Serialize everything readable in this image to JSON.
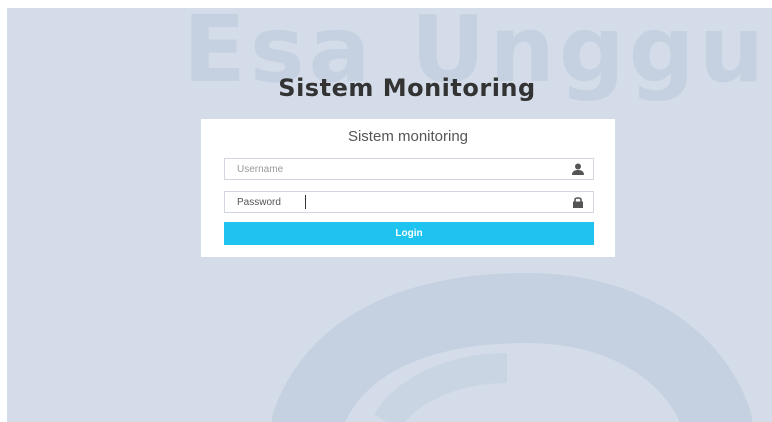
{
  "watermark": {
    "text": "Esa Unggul"
  },
  "page": {
    "title": "Sistem Monitoring"
  },
  "login_box": {
    "title": "Sistem monitoring",
    "username": {
      "placeholder": "Username",
      "value": "",
      "icon": "user-icon"
    },
    "password": {
      "placeholder": "Password",
      "value": "Password",
      "icon": "lock-icon"
    },
    "login_label": "Login"
  },
  "colors": {
    "background": "#d3dce8",
    "watermark": "#c5d1e0",
    "button": "#1ec3ef",
    "title_text": "#333333"
  }
}
